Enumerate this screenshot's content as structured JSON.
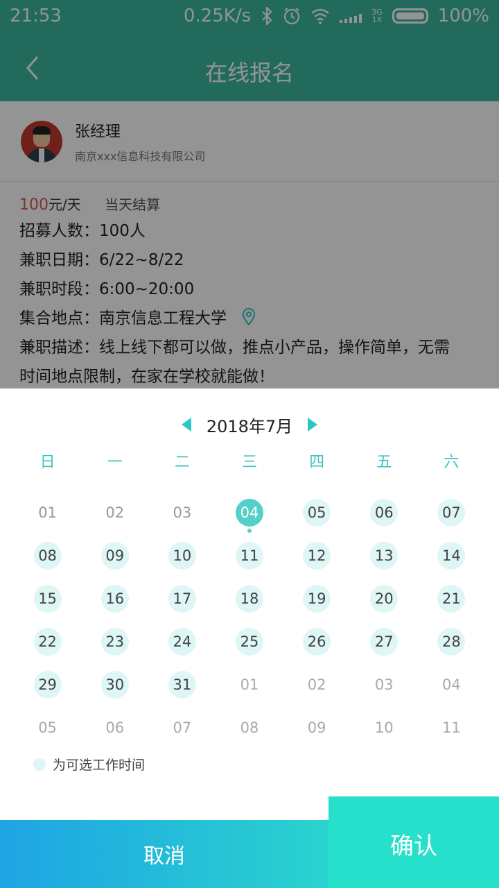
{
  "status_bar": {
    "time": "21:53",
    "speed": "0.25K/s",
    "network_top": "3G",
    "network_bottom": "1X",
    "battery": "100%"
  },
  "header": {
    "title": "在线报名",
    "back_icon": "chevron-left-icon"
  },
  "profile": {
    "name": "张经理",
    "company": "南京xxx信息科技有限公司"
  },
  "job": {
    "pay_amount": "100",
    "pay_unit": "元/天",
    "settlement": "当天结算",
    "recruit": "招募人数：100人",
    "dates": "兼职日期：6/22~8/22",
    "hours": "兼职时段：6:00~20:00",
    "location": "集合地点：南京信息工程大学",
    "desc_line1": "兼职描述：线上线下都可以做，推点小产品，操作简单，无需",
    "desc_line2": "时间地点限制，在家在学校就能做！"
  },
  "calendar": {
    "month_label": "2018年7月",
    "weekdays": [
      "日",
      "一",
      "二",
      "三",
      "四",
      "五",
      "六"
    ],
    "days": [
      {
        "label": "01",
        "state": "normal"
      },
      {
        "label": "02",
        "state": "normal"
      },
      {
        "label": "03",
        "state": "normal"
      },
      {
        "label": "04",
        "state": "selected"
      },
      {
        "label": "05",
        "state": "available"
      },
      {
        "label": "06",
        "state": "available"
      },
      {
        "label": "07",
        "state": "available"
      },
      {
        "label": "08",
        "state": "available"
      },
      {
        "label": "09",
        "state": "available"
      },
      {
        "label": "10",
        "state": "available"
      },
      {
        "label": "11",
        "state": "available"
      },
      {
        "label": "12",
        "state": "available"
      },
      {
        "label": "13",
        "state": "available"
      },
      {
        "label": "14",
        "state": "available"
      },
      {
        "label": "15",
        "state": "available"
      },
      {
        "label": "16",
        "state": "available"
      },
      {
        "label": "17",
        "state": "available"
      },
      {
        "label": "18",
        "state": "available"
      },
      {
        "label": "19",
        "state": "available"
      },
      {
        "label": "20",
        "state": "available"
      },
      {
        "label": "21",
        "state": "available"
      },
      {
        "label": "22",
        "state": "available"
      },
      {
        "label": "23",
        "state": "available"
      },
      {
        "label": "24",
        "state": "available"
      },
      {
        "label": "25",
        "state": "available"
      },
      {
        "label": "26",
        "state": "available"
      },
      {
        "label": "27",
        "state": "available"
      },
      {
        "label": "28",
        "state": "available"
      },
      {
        "label": "29",
        "state": "available"
      },
      {
        "label": "30",
        "state": "available"
      },
      {
        "label": "31",
        "state": "available"
      },
      {
        "label": "01",
        "state": "other"
      },
      {
        "label": "02",
        "state": "other"
      },
      {
        "label": "03",
        "state": "other"
      },
      {
        "label": "04",
        "state": "other"
      },
      {
        "label": "05",
        "state": "other"
      },
      {
        "label": "06",
        "state": "other"
      },
      {
        "label": "07",
        "state": "other"
      },
      {
        "label": "08",
        "state": "other"
      },
      {
        "label": "09",
        "state": "other"
      },
      {
        "label": "10",
        "state": "other"
      },
      {
        "label": "11",
        "state": "other"
      }
    ],
    "legend": "为可选工作时间"
  },
  "actions": {
    "cancel": "取消",
    "confirm": "确认"
  },
  "colors": {
    "primary": "#3ab79f",
    "accent": "#2bc7c0",
    "available_bg": "#def6f5",
    "selected_bg": "#55cfc9",
    "price": "#d9534f"
  }
}
